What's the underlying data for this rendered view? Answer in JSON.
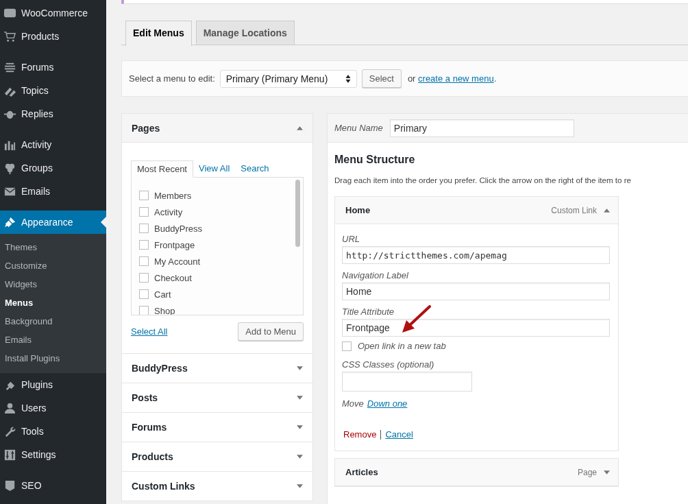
{
  "sidebar": {
    "sections": [
      {
        "items": [
          {
            "label": "WooCommerce",
            "selected": false
          },
          {
            "label": "Products",
            "selected": false
          }
        ]
      },
      {
        "items": [
          {
            "label": "Forums",
            "selected": false
          },
          {
            "label": "Topics",
            "selected": false
          },
          {
            "label": "Replies",
            "selected": false
          }
        ]
      },
      {
        "items": [
          {
            "label": "Activity",
            "selected": false
          },
          {
            "label": "Groups",
            "selected": false
          },
          {
            "label": "Emails",
            "selected": false
          }
        ]
      },
      {
        "items": [
          {
            "label": "Appearance",
            "selected": true,
            "children": [
              {
                "label": "Themes",
                "selected": false
              },
              {
                "label": "Customize",
                "selected": false
              },
              {
                "label": "Widgets",
                "selected": false
              },
              {
                "label": "Menus",
                "selected": true
              },
              {
                "label": "Background",
                "selected": false
              },
              {
                "label": "Emails",
                "selected": false
              },
              {
                "label": "Install Plugins",
                "selected": false
              }
            ]
          },
          {
            "label": "Plugins",
            "selected": false
          },
          {
            "label": "Users",
            "selected": false
          },
          {
            "label": "Tools",
            "selected": false
          },
          {
            "label": "Settings",
            "selected": false
          }
        ]
      },
      {
        "items": [
          {
            "label": "SEO",
            "selected": false
          }
        ]
      }
    ]
  },
  "tabs": [
    {
      "label": "Edit Menus",
      "selected": true
    },
    {
      "label": "Manage Locations",
      "selected": false
    }
  ],
  "menu_select": {
    "label": "Select a menu to edit:",
    "value": "Primary (Primary Menu)",
    "button": "Select",
    "or_text": "or",
    "create_link": "create a new menu",
    "end": "."
  },
  "pages_panel": {
    "title": "Pages",
    "expanded": true,
    "tabs": [
      {
        "label": "Most Recent",
        "selected": true
      },
      {
        "label": "View All",
        "selected": false
      },
      {
        "label": "Search",
        "selected": false
      }
    ],
    "items": [
      {
        "label": "Members",
        "checked": false
      },
      {
        "label": "Activity",
        "checked": false
      },
      {
        "label": "BuddyPress",
        "checked": false
      },
      {
        "label": "Frontpage",
        "checked": false
      },
      {
        "label": "My Account",
        "checked": false
      },
      {
        "label": "Checkout",
        "checked": false
      },
      {
        "label": "Cart",
        "checked": false
      },
      {
        "label": "Shop",
        "checked": false
      }
    ],
    "select_all": "Select All",
    "add_button": "Add to Menu"
  },
  "accordion": [
    {
      "title": "BuddyPress",
      "expanded": false
    },
    {
      "title": "Posts",
      "expanded": false
    },
    {
      "title": "Forums",
      "expanded": false
    },
    {
      "title": "Products",
      "expanded": false
    },
    {
      "title": "Custom Links",
      "expanded": false
    }
  ],
  "menu_name": {
    "label": "Menu Name",
    "value": "Primary"
  },
  "structure": {
    "title": "Menu Structure",
    "description": "Drag each item into the order you prefer. Click the arrow on the right of the item to re"
  },
  "menu_items": [
    {
      "title": "Home",
      "type": "Custom Link",
      "expanded": true,
      "url_label": "URL",
      "url": "http://strictthemes.com/apemag",
      "nav_label_label": "Navigation Label",
      "nav_label": "Home",
      "title_attr_label": "Title Attribute",
      "title_attr": "Frontpage",
      "new_tab": {
        "label": "Open link in a new tab",
        "checked": false
      },
      "css_label": "CSS Classes (optional)",
      "move_label": "Move",
      "move_link": "Down one",
      "remove": "Remove",
      "cancel": "Cancel"
    },
    {
      "title": "Articles",
      "type": "Page",
      "expanded": false
    }
  ]
}
